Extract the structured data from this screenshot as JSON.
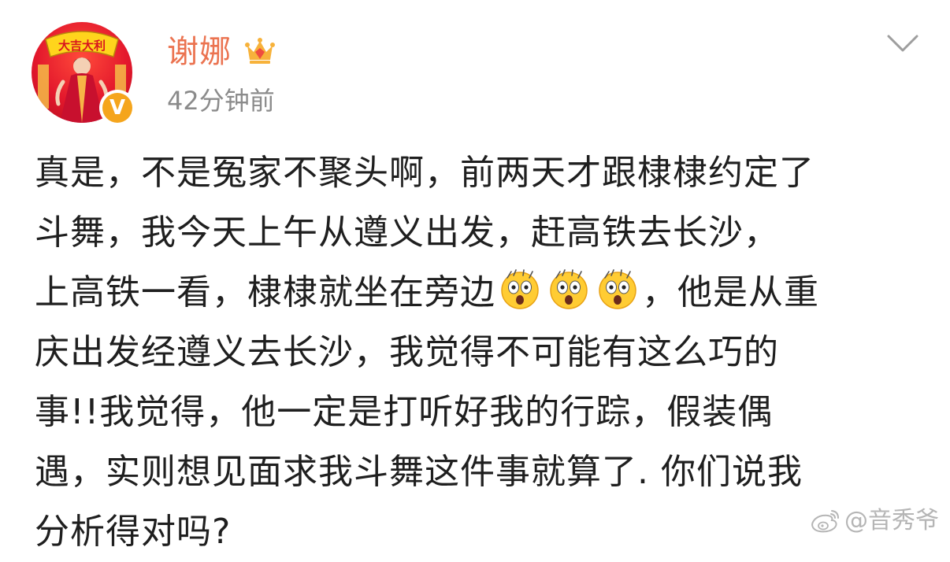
{
  "author": {
    "name": "谢娜",
    "time": "42分钟前",
    "avatar_banner": "大吉大利",
    "verified_badge": "V",
    "crown_icon": "crown-icon",
    "menu_icon": "chevron-down-icon"
  },
  "post": {
    "lines": [
      "真是，不是冤家不聚头啊，前两天才跟棣棣约定了",
      "斗舞，我今天上午从遵义出发，赶高铁去长沙，",
      "上高铁一看，棣棣就坐在旁边",
      "，他是从重",
      "庆出发经遵义去长沙，我觉得不可能有这么巧的",
      "事!!我觉得，他一定是打听好我的行踪，假装偶",
      "遇，实则想见面求我斗舞这件事就算了. 你们说我",
      "分析得对吗?"
    ],
    "emoji_name": "astonished-emoji-icon"
  },
  "watermark": {
    "text": "@音秀爷",
    "icon": "weibo-logo-icon"
  },
  "colors": {
    "username": "#eb7350",
    "timestamp": "#8b8b8b",
    "text": "#1f1f1f",
    "badge": "#f5a51c",
    "avatar_bg": "#e3182c"
  }
}
